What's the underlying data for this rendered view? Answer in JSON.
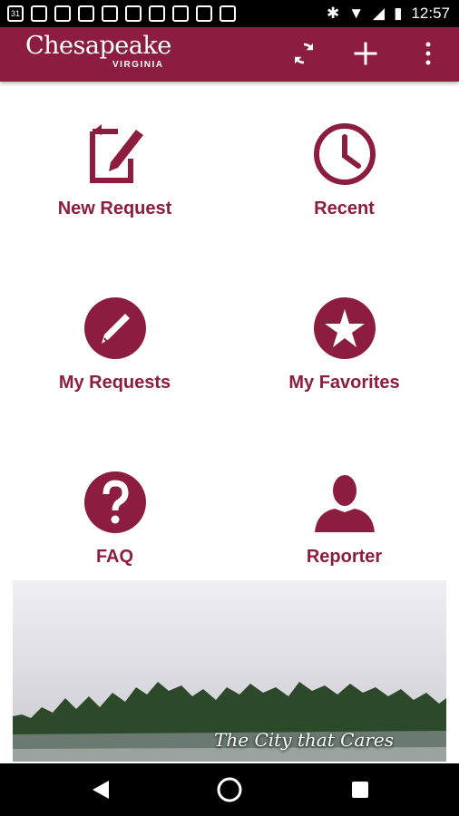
{
  "status": {
    "time": "12:57",
    "calendar_day": "31"
  },
  "app": {
    "logo_name": "Chesapeake",
    "logo_state": "VIRGINIA"
  },
  "menu": [
    {
      "label": "New Request",
      "icon": "edit-document-icon"
    },
    {
      "label": "Recent",
      "icon": "clock-icon"
    },
    {
      "label": "My Requests",
      "icon": "pencil-circle-icon"
    },
    {
      "label": "My Favorites",
      "icon": "star-circle-icon"
    },
    {
      "label": "FAQ",
      "icon": "question-circle-icon"
    },
    {
      "label": "Reporter",
      "icon": "person-icon"
    }
  ],
  "banner": {
    "caption": "The City that Cares"
  },
  "colors": {
    "brand": "#8c1d3e",
    "statusbar": "#000000"
  }
}
